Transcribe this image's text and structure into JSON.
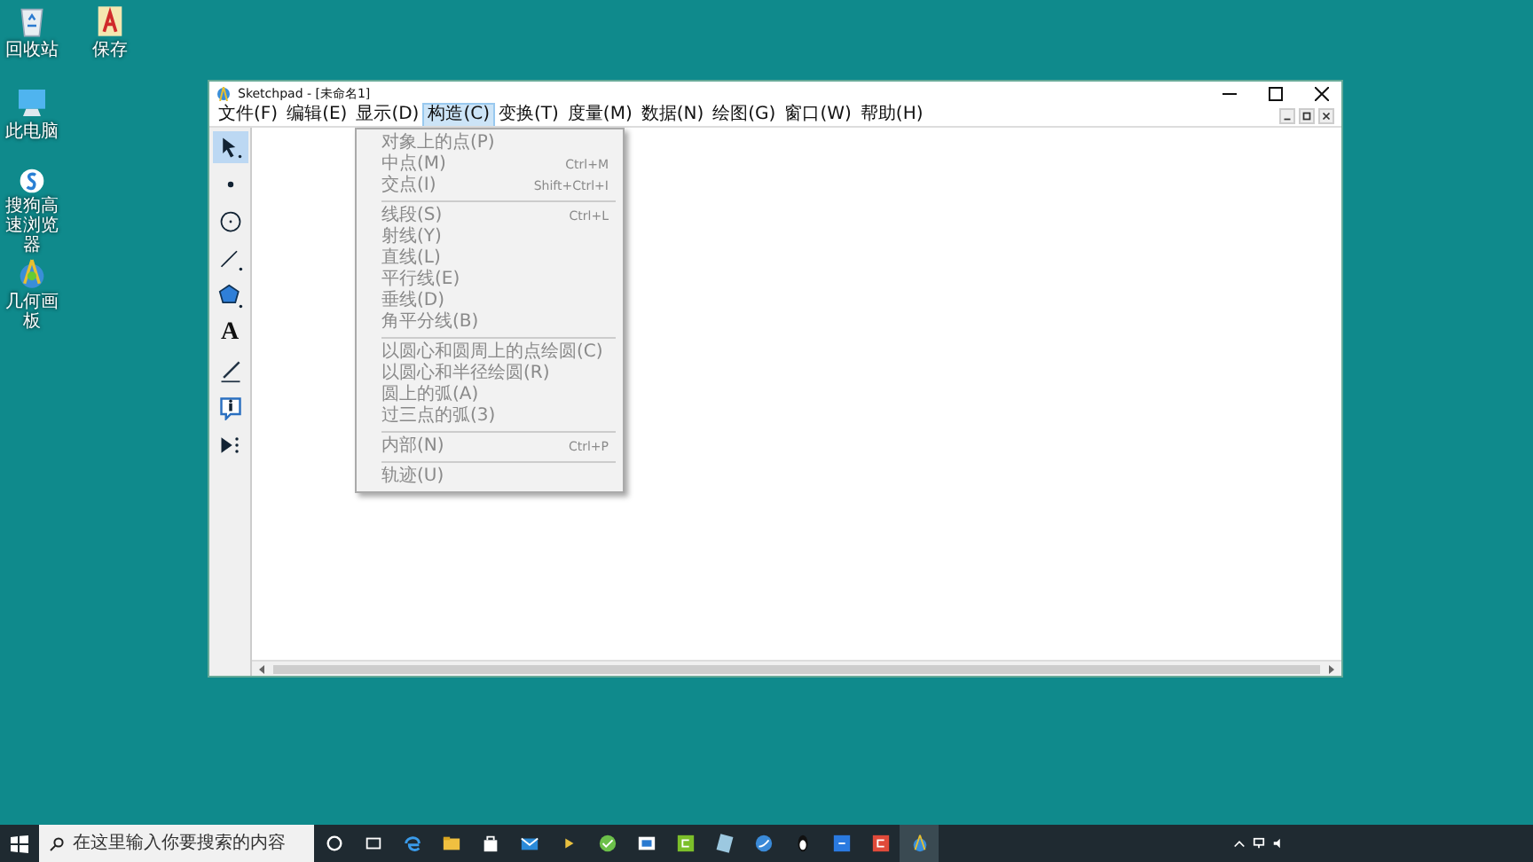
{
  "desktop_icons": [
    {
      "kind": "recycle",
      "label": "回收站"
    },
    {
      "kind": "computer",
      "label": "此电脑"
    },
    {
      "kind": "browser",
      "label": "搜狗高速浏览器"
    },
    {
      "kind": "geometry",
      "label": "几何画板"
    },
    {
      "kind": "document",
      "label": "保存"
    }
  ],
  "window": {
    "title": "Sketchpad  - [未命名1]"
  },
  "menu_bar": [
    {
      "label": "文件(F)",
      "selected": false
    },
    {
      "label": "编辑(E)",
      "selected": false
    },
    {
      "label": "显示(D)",
      "selected": false
    },
    {
      "label": "构造(C)",
      "selected": true
    },
    {
      "label": "变换(T)",
      "selected": false
    },
    {
      "label": "度量(M)",
      "selected": false
    },
    {
      "label": "数据(N)",
      "selected": false
    },
    {
      "label": "绘图(G)",
      "selected": false
    },
    {
      "label": "窗口(W)",
      "selected": false
    },
    {
      "label": "帮助(H)",
      "selected": false
    }
  ],
  "dropdown_menu": {
    "groups": [
      [
        {
          "label": "对象上的点(P)",
          "disabled": true
        },
        {
          "label": "中点(M)",
          "shortcut": "Ctrl+M",
          "disabled": true
        },
        {
          "label": "交点(I)",
          "shortcut": "Shift+Ctrl+I",
          "disabled": true
        }
      ],
      [
        {
          "label": "线段(S)",
          "shortcut": "Ctrl+L",
          "disabled": true
        },
        {
          "label": "射线(Y)",
          "disabled": true
        },
        {
          "label": "直线(L)",
          "disabled": true
        },
        {
          "label": "平行线(E)",
          "disabled": true
        },
        {
          "label": "垂线(D)",
          "disabled": true
        },
        {
          "label": "角平分线(B)",
          "disabled": true
        }
      ],
      [
        {
          "label": "以圆心和圆周上的点绘圆(C)",
          "disabled": true
        },
        {
          "label": "以圆心和半径绘圆(R)",
          "disabled": true
        },
        {
          "label": "圆上的弧(A)",
          "disabled": true
        },
        {
          "label": "过三点的弧(3)",
          "disabled": true
        }
      ],
      [
        {
          "label": "内部(N)",
          "shortcut": "Ctrl+P",
          "disabled": true
        }
      ],
      [
        {
          "label": "轨迹(U)",
          "disabled": true
        }
      ]
    ]
  },
  "toolbox": [
    {
      "kind": "arrow",
      "selected": true
    },
    {
      "kind": "point",
      "selected": false
    },
    {
      "kind": "compass",
      "selected": false
    },
    {
      "kind": "line",
      "selected": false
    },
    {
      "kind": "polygon",
      "selected": false
    },
    {
      "kind": "text",
      "label": "A",
      "selected": false
    },
    {
      "kind": "marker",
      "selected": false
    },
    {
      "kind": "info",
      "selected": false
    },
    {
      "kind": "custom",
      "selected": false
    }
  ],
  "taskbar": {
    "search": {
      "placeholder": "在这里输入你要搜索的内容"
    }
  }
}
